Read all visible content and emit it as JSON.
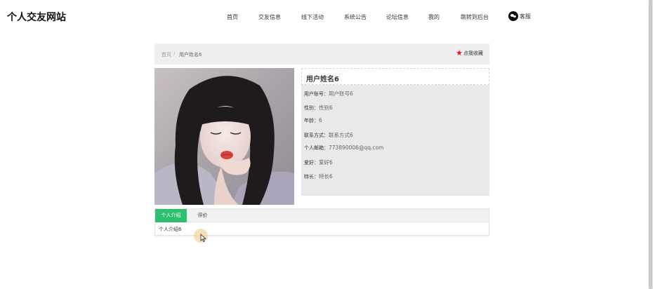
{
  "header": {
    "site_title": "个人交友网站",
    "nav": [
      "首页",
      "交友信息",
      "线下活动",
      "系统公告",
      "论坛信息",
      "我的",
      "跳转到后台"
    ],
    "service_label": "客服"
  },
  "breadcrumb": {
    "home": "首页",
    "separator": "/",
    "current": "用户姓名6"
  },
  "favorite_label": "点我收藏",
  "profile": {
    "name": "用户姓名6",
    "fields": [
      {
        "label": "用户账号：",
        "value": "用户账号6"
      },
      {
        "label": "性别：",
        "value": "性别6"
      },
      {
        "label": "年龄：",
        "value": "6"
      },
      {
        "label": "联系方式：",
        "value": "联系方式6"
      },
      {
        "label": "个人邮箱：",
        "value": "773890006@qq.com"
      },
      {
        "label": "爱好：",
        "value": "爱好6"
      },
      {
        "label": "特长：",
        "value": "特长6"
      }
    ]
  },
  "tabs": [
    "个人介绍",
    "评价"
  ],
  "tab_content": "个人介绍6",
  "colors": {
    "accent": "#2fbf71",
    "star": "#e11111",
    "panel_bg": "#e9e9e9"
  }
}
